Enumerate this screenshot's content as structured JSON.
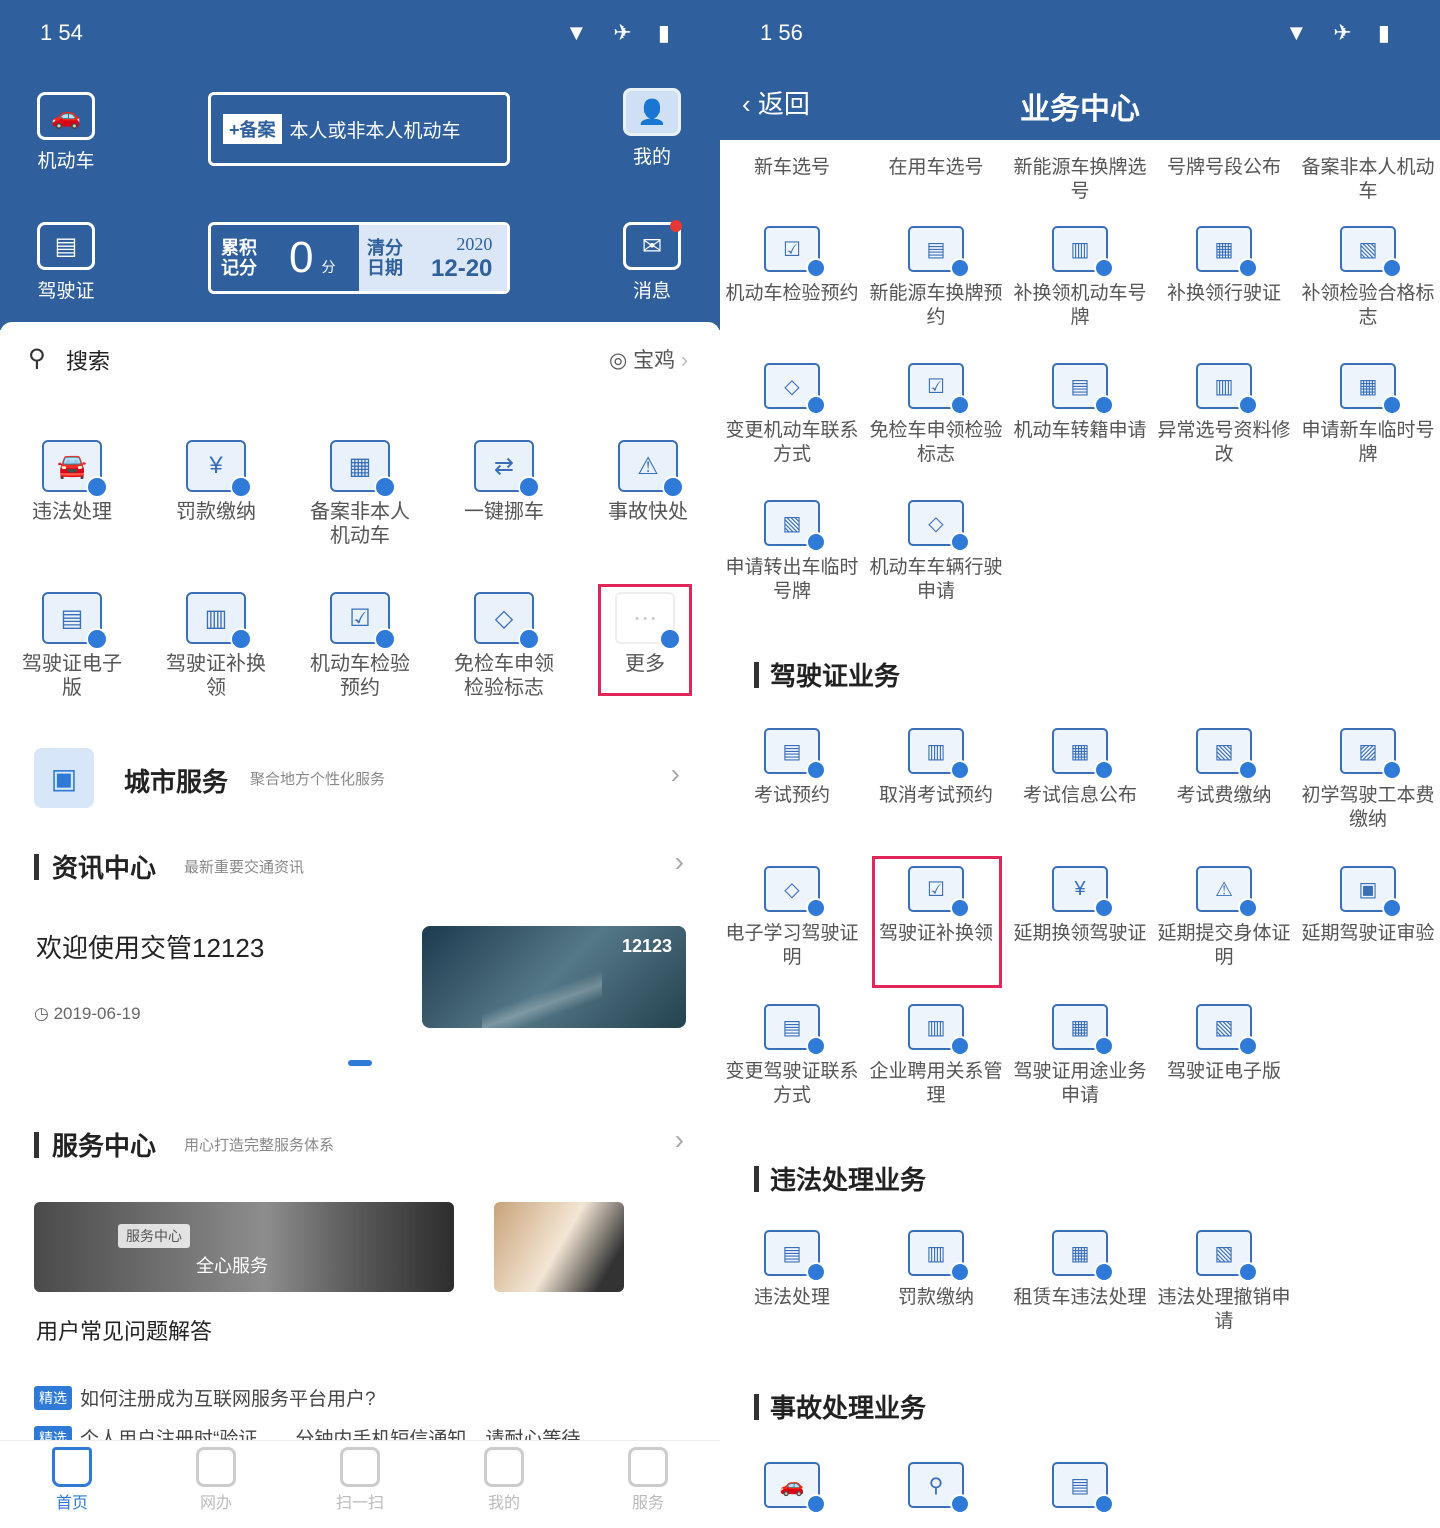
{
  "left": {
    "status": {
      "time": "1 54",
      "icons": "▼ ✈ ▮"
    },
    "header": {
      "vehicle_label": "机动车",
      "license_label": "驾驶证",
      "mine_label": "我的",
      "message_label": "消息",
      "filing_tag": "+备案",
      "filing_text": "本人或非本人机动车",
      "points_label": "累积记分",
      "points_value": "0",
      "points_unit": "分",
      "clear_label": "清分日期",
      "clear_year": "2020",
      "clear_date": "12-20"
    },
    "search": {
      "label": "搜索",
      "location": "宝鸡"
    },
    "grid": [
      {
        "label": "违法处理",
        "icon": "car-violation-icon"
      },
      {
        "label": "罚款缴纳",
        "icon": "fine-payment-icon"
      },
      {
        "label": "备案非本人机动车",
        "icon": "filing-icon"
      },
      {
        "label": "一键挪车",
        "icon": "move-car-icon"
      },
      {
        "label": "事故快处",
        "icon": "accident-icon"
      },
      {
        "label": "驾驶证电子版",
        "icon": "e-license-icon"
      },
      {
        "label": "驾驶证补换领",
        "icon": "license-replace-icon"
      },
      {
        "label": "机动车检验预约",
        "icon": "inspection-icon"
      },
      {
        "label": "免检车申领检验标志",
        "icon": "exempt-mark-icon"
      },
      {
        "label": "更多",
        "icon": "more-icon"
      }
    ],
    "city": {
      "title": "城市服务",
      "subtitle": "聚合地方个性化服务"
    },
    "news": {
      "title": "资讯中心",
      "subtitle": "最新重要交通资讯",
      "headline": "欢迎使用交管12123",
      "date": "2019-06-19",
      "image_brand": "12123"
    },
    "service": {
      "title": "服务中心",
      "subtitle": "用心打造完整服务体系",
      "image_pill": "服务中心",
      "image_caption": "全心服务",
      "faq_title": "用户常见问题解答",
      "faq_tag": "精选",
      "faq1": "如何注册成为互联网服务平台用户?",
      "faq2": "个人用户注册时“验证……分钟内手机短信通知，请耐心等待"
    },
    "tabs": [
      {
        "label": "首页"
      },
      {
        "label": "网办"
      },
      {
        "label": "扫一扫"
      },
      {
        "label": "我的"
      },
      {
        "label": "服务"
      }
    ]
  },
  "right": {
    "status": {
      "time": "1 56",
      "icons": "▼ ✈ ▮"
    },
    "back_label": "返回",
    "title": "业务中心",
    "vehicle_items": [
      "新车选号",
      "在用车选号",
      "新能源车换牌选号",
      "号牌号段公布",
      "备案非本人机动车",
      "机动车检验预约",
      "新能源车换牌预约",
      "补换领机动车号牌",
      "补换领行驶证",
      "补领检验合格标志",
      "变更机动车联系方式",
      "免检车申领检验标志",
      "机动车转籍申请",
      "异常选号资料修改",
      "申请新车临时号牌",
      "申请转出车临时号牌",
      "机动车车辆行驶申请"
    ],
    "license_section": "驾驶证业务",
    "license_items": [
      "考试预约",
      "取消考试预约",
      "考试信息公布",
      "考试费缴纳",
      "初学驾驶工本费缴纳",
      "电子学习驾驶证明",
      "驾驶证补换领",
      "延期换领驾驶证",
      "延期提交身体证明",
      "延期驾驶证审验",
      "变更驾驶证联系方式",
      "企业聘用关系管理",
      "驾驶证用途业务申请",
      "驾驶证电子版"
    ],
    "violation_section": "违法处理业务",
    "violation_items": [
      "违法处理",
      "罚款缴纳",
      "租赁车违法处理",
      "违法处理撤销申请"
    ],
    "accident_section": "事故处理业务"
  }
}
